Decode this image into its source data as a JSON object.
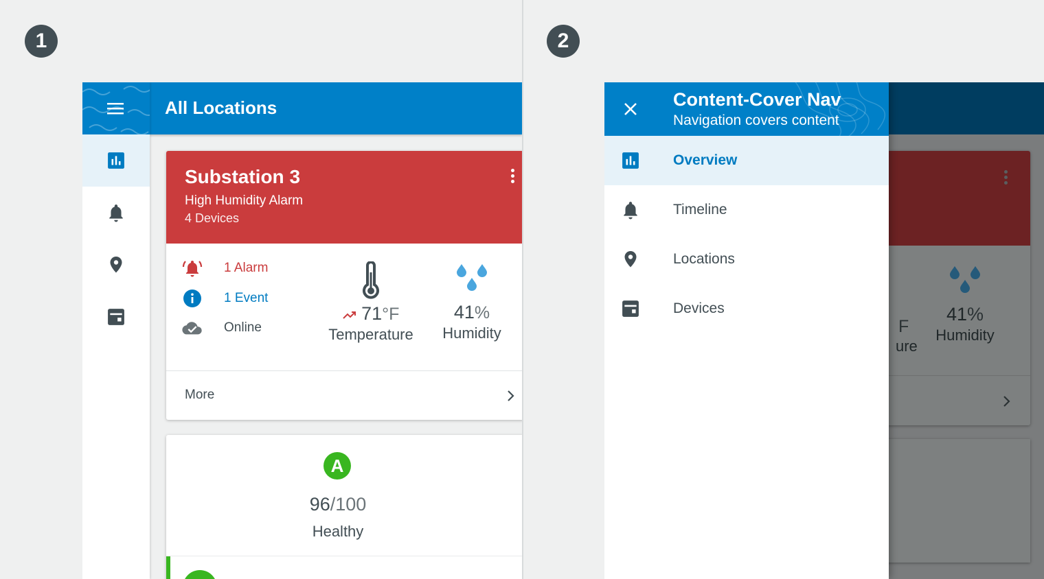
{
  "steps": {
    "one": "1",
    "two": "2"
  },
  "colors": {
    "primary": "#0080c8",
    "alarm": "#ca3c3d",
    "event": "#007bc1",
    "success": "#39b620",
    "text": "#424e54"
  },
  "panel1": {
    "appbar_title": "All Locations",
    "rail_icons": [
      "menu-icon",
      "chart-icon",
      "bell-icon",
      "location-pin-icon",
      "device-icon"
    ],
    "card": {
      "title": "Substation 3",
      "subtitle": "High Humidity Alarm",
      "devices": "4 Devices",
      "status": {
        "alarm": "1 Alarm",
        "event": "1 Event",
        "online": "Online"
      },
      "temperature": {
        "value": "71",
        "unit": "°F",
        "label": "Temperature",
        "trend": "trending-up-icon"
      },
      "humidity": {
        "value": "41",
        "unit": "%",
        "label": "Humidity"
      },
      "more_label": "More"
    },
    "score": {
      "grade": "A",
      "value": "96",
      "max": "/100",
      "label": "Healthy"
    }
  },
  "panel2": {
    "drawer_title": "Content-Cover Nav",
    "drawer_subtitle": "Navigation covers content",
    "nav_items": [
      {
        "label": "Overview",
        "icon": "chart-icon",
        "active": true
      },
      {
        "label": "Timeline",
        "icon": "bell-icon",
        "active": false
      },
      {
        "label": "Locations",
        "icon": "location-pin-icon",
        "active": false
      },
      {
        "label": "Devices",
        "icon": "device-icon",
        "active": false
      }
    ],
    "background": {
      "fragment_unit": "F",
      "fragment_label": "ure",
      "humidity_value": "41",
      "humidity_unit": "%",
      "humidity_label": "Humidity"
    }
  }
}
